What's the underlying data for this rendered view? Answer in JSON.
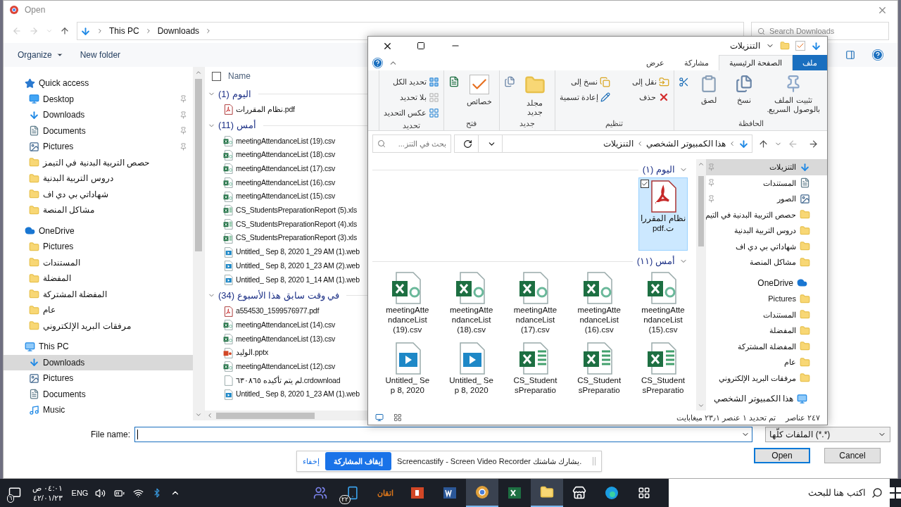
{
  "dialog": {
    "title": "Open",
    "breadcrumb": {
      "root": "This PC",
      "folder": "Downloads"
    },
    "search_placeholder": "Search Downloads",
    "organize": {
      "label": "Organize",
      "menu": true
    },
    "new_folder": {
      "label": "New folder",
      "menu": false
    },
    "nav": [
      {
        "label": "Quick access",
        "kind": "quick",
        "children": [
          {
            "label": "Desktop",
            "kind": "desktop",
            "pinned": true,
            "selected": false
          },
          {
            "label": "Downloads",
            "kind": "downloads",
            "pinned": true,
            "selected": false
          },
          {
            "label": "Documents",
            "kind": "documents",
            "pinned": true,
            "selected": false
          },
          {
            "label": "Pictures",
            "kind": "pictures",
            "pinned": true,
            "selected": false
          },
          {
            "label": "حصص التربية البدنية في التيمز",
            "kind": "folder",
            "pinned": false,
            "selected": false
          },
          {
            "label": "دروس التربية البدنية",
            "kind": "folder",
            "pinned": false,
            "selected": false
          },
          {
            "label": "شهاداتي بي دي اف",
            "kind": "folder",
            "pinned": false,
            "selected": false
          },
          {
            "label": "مشاكل المنصة",
            "kind": "folder",
            "pinned": false,
            "selected": false
          }
        ]
      },
      {
        "label": "OneDrive",
        "kind": "onedrive",
        "children": [
          {
            "label": "Pictures",
            "kind": "folder",
            "pinned": false,
            "selected": false
          },
          {
            "label": "المستندات",
            "kind": "folder",
            "pinned": false,
            "selected": false
          },
          {
            "label": "المفضلة",
            "kind": "folder",
            "pinned": false,
            "selected": false
          },
          {
            "label": "المفضلة المشتركة",
            "kind": "folder",
            "pinned": false,
            "selected": false
          },
          {
            "label": "عام",
            "kind": "folder",
            "pinned": false,
            "selected": false
          },
          {
            "label": "مرفقات البريد الإلكتروني",
            "kind": "folder",
            "pinned": false,
            "selected": false
          }
        ]
      },
      {
        "label": "This PC",
        "kind": "pc",
        "children": [
          {
            "label": "Downloads",
            "kind": "downloads",
            "pinned": false,
            "selected": true
          },
          {
            "label": "Pictures",
            "kind": "pictures",
            "pinned": false,
            "selected": false
          },
          {
            "label": "Documents",
            "kind": "documents",
            "pinned": false,
            "selected": false
          },
          {
            "label": "Music",
            "kind": "music",
            "pinned": false,
            "selected": false
          }
        ]
      }
    ],
    "list_header": "Name",
    "select_all_checked": false,
    "groups": [
      {
        "label": "(1) اليوم",
        "expanded": true,
        "files": [
          {
            "name": "نظام المقررات.pdf",
            "kind": "pdf"
          }
        ]
      },
      {
        "label": "(11) أمس",
        "expanded": true,
        "files": [
          {
            "name": "meetingAttendanceList (19).csv",
            "kind": "csv"
          },
          {
            "name": "meetingAttendanceList (18).csv",
            "kind": "csv"
          },
          {
            "name": "meetingAttendanceList (17).csv",
            "kind": "csv"
          },
          {
            "name": "meetingAttendanceList (16).csv",
            "kind": "csv"
          },
          {
            "name": "meetingAttendanceList (15).csv",
            "kind": "csv"
          },
          {
            "name": "CS_StudentsPreparationReport (5).xls",
            "kind": "xlsx"
          },
          {
            "name": "CS_StudentsPreparationReport (4).xls",
            "kind": "xlsx"
          },
          {
            "name": "CS_StudentsPreparationReport (3).xls",
            "kind": "xlsx"
          },
          {
            "name": "Untitled_ Sep 8, 2020 1_29 AM (1).web",
            "kind": "video"
          },
          {
            "name": "Untitled_ Sep 8, 2020 1_23 AM (2).web",
            "kind": "video"
          },
          {
            "name": "Untitled_ Sep 8, 2020 1_14 AM (1).web",
            "kind": "video"
          }
        ]
      },
      {
        "label": "(34) في وقت سابق هذا الأسبوع",
        "expanded": true,
        "files": [
          {
            "name": "a554530_1599576977.pdf",
            "kind": "pdf"
          },
          {
            "name": "meetingAttendanceList (14).csv",
            "kind": "csv"
          },
          {
            "name": "meetingAttendanceList (13).csv",
            "kind": "csv"
          },
          {
            "name": "الوليد.pptx",
            "kind": "pptx"
          },
          {
            "name": "meetingAttendanceList (12).csv",
            "kind": "csv"
          },
          {
            "name": "لم يتم تأكيده ٦٣٠٨٦٥.crdownload",
            "kind": "blank"
          },
          {
            "name": "Untitled_ Sep 8, 2020 1_23 AM (1).web",
            "kind": "video"
          }
        ]
      }
    ],
    "file_name_label": "File name:",
    "file_type": "الملفات كلّها (*.*)",
    "open_button": {
      "label": "Open",
      "default": true
    },
    "cancel_button": {
      "label": "Cancel",
      "default": false
    }
  },
  "explorer": {
    "title": "التنزيلات",
    "tabs": [
      {
        "label": "ملف",
        "kind": "file",
        "selected": false
      },
      {
        "label": "الصفحة الرئيسية",
        "kind": "tab",
        "selected": true
      },
      {
        "label": "مشاركة",
        "kind": "tab",
        "selected": false
      },
      {
        "label": "عرض",
        "kind": "tab",
        "selected": false
      }
    ],
    "ribbon": [
      {
        "label": "الحافظة",
        "commands": [
          {
            "label": "تثبيت الملف بالوصول السريع.",
            "kind": "pin"
          },
          {
            "label": "نسخ",
            "kind": "copy"
          },
          {
            "label": "لصق",
            "kind": "paste"
          },
          {
            "kind": "cut"
          }
        ]
      },
      {
        "label": "تنظيم",
        "commands": [
          {
            "label": "نقل إلى",
            "kind": "move"
          },
          {
            "label": "نسخ إلى",
            "kind": "copyto"
          },
          {
            "label": "حذف",
            "kind": "delete"
          },
          {
            "label": "إعادة تسمية",
            "kind": "rename"
          }
        ]
      },
      {
        "label": "جديد",
        "commands": [
          {
            "label": "مجلد جديد",
            "kind": "newfolder"
          },
          {
            "kind": "newitem"
          }
        ]
      },
      {
        "label": "فتح",
        "commands": [
          {
            "label": "خصائص",
            "kind": "properties"
          },
          {
            "kind": "open"
          }
        ]
      },
      {
        "label": "تحديد",
        "commands": [
          {
            "label": "تحديد الكل",
            "kind": "selectall"
          },
          {
            "label": "بلا تحديد",
            "kind": "selectnone"
          },
          {
            "label": "عكس التحديد",
            "kind": "invert"
          }
        ]
      }
    ],
    "breadcrumb": [
      "هذا الكمبيوتر الشخصي",
      "التنزيلات"
    ],
    "search_placeholder": "بحث في التنز...",
    "nav": [
      {
        "children": [
          {
            "label": "التنزيلات",
            "kind": "downloads",
            "pinned": true,
            "selected": true
          },
          {
            "label": "المستندات",
            "kind": "documents",
            "pinned": true,
            "selected": false
          },
          {
            "label": "الصور",
            "kind": "pictures",
            "pinned": true,
            "selected": false
          },
          {
            "label": "حصص التربية البدنية في التيم",
            "kind": "folder",
            "pinned": false,
            "selected": false
          },
          {
            "label": "دروس التربية البدنية",
            "kind": "folder",
            "pinned": false,
            "selected": false
          },
          {
            "label": "شهاداتي بي دي اف",
            "kind": "folder",
            "pinned": false,
            "selected": false
          },
          {
            "label": "مشاكل المنصة",
            "kind": "folder",
            "pinned": false,
            "selected": false
          }
        ]
      },
      {
        "label": "OneDrive",
        "kind": "onedrive",
        "children": [
          {
            "label": "Pictures",
            "kind": "folder",
            "pinned": false,
            "selected": false
          },
          {
            "label": "المستندات",
            "kind": "folder",
            "pinned": false,
            "selected": false
          },
          {
            "label": "المفضلة",
            "kind": "folder",
            "pinned": false,
            "selected": false
          },
          {
            "label": "المفضلة المشتركة",
            "kind": "folder",
            "pinned": false,
            "selected": false
          },
          {
            "label": "عام",
            "kind": "folder",
            "pinned": false,
            "selected": false
          },
          {
            "label": "مرفقات البريد الإلكتروني",
            "kind": "folder",
            "pinned": false,
            "selected": false
          }
        ]
      },
      {
        "label": "هذا الكمبيوتر الشخصي",
        "kind": "pc"
      }
    ],
    "groups": [
      {
        "label": "اليوم (١)",
        "files": [
          {
            "name": "نظام المقررات.pdf",
            "kind": "pdf",
            "selected": true
          }
        ]
      },
      {
        "label": "أمس (١١)",
        "files": [
          {
            "name": "meetingAttendanceList (15).csv",
            "kind": "csv",
            "selected": false
          },
          {
            "name": "meetingAttendanceList (16).csv",
            "kind": "csv",
            "selected": false
          },
          {
            "name": "meetingAttendanceList (17).csv",
            "kind": "csv",
            "selected": false
          },
          {
            "name": "meetingAttendanceList (18).csv",
            "kind": "csv",
            "selected": false
          },
          {
            "name": "meetingAttendanceList (19).csv",
            "kind": "csv",
            "selected": false
          },
          {
            "name": "CS_StudentsPreparatio",
            "kind": "xlsx",
            "selected": false
          },
          {
            "name": "CS_StudentsPreparatio",
            "kind": "xlsx",
            "selected": false
          },
          {
            "name": "CS_StudentsPreparatio",
            "kind": "xlsx",
            "selected": false
          },
          {
            "name": "Untitled_ Sep 8, 2020",
            "kind": "video",
            "selected": false
          },
          {
            "name": "Untitled_ Sep 8, 2020",
            "kind": "video",
            "selected": false
          }
        ]
      }
    ],
    "status": [
      "٢٤٧ عناصر",
      "تم تحديد ١ عنصر ٢٣٫١ ميغابايت"
    ]
  },
  "share_bar": {
    "message": "Screencastify - Screen Video Recorder يشارك شاشتك.",
    "stop": "إيقاف المشاركة",
    "hide": "إخفاء"
  },
  "taskbar": {
    "search_placeholder": "اكتب هنا للبحث",
    "apps": [
      {
        "kind": "taskview",
        "active": false
      },
      {
        "kind": "edge",
        "active": false
      },
      {
        "kind": "store",
        "active": false
      },
      {
        "kind": "files",
        "active": true
      },
      {
        "kind": "excel",
        "active": false
      },
      {
        "kind": "chrome",
        "active": true
      },
      {
        "kind": "word",
        "active": false
      },
      {
        "kind": "powerpoint",
        "active": false
      },
      {
        "kind": "text",
        "label": "اتقان",
        "active": false
      },
      {
        "kind": "phone",
        "badge": "٢٢",
        "active": false
      },
      {
        "kind": "teams",
        "active": false
      }
    ],
    "language": "ENG",
    "time": "٠٤:٠١ ص",
    "date": "٤٢/٠١/٢٣",
    "notifications": "٦"
  }
}
